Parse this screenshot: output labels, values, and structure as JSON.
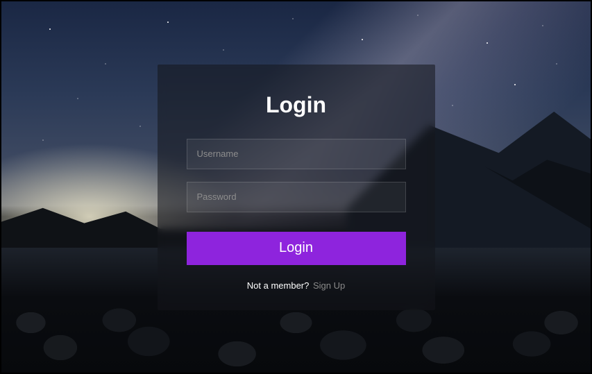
{
  "form": {
    "title": "Login",
    "username_placeholder": "Username",
    "username_value": "",
    "password_placeholder": "Password",
    "password_value": "",
    "submit_label": "Login"
  },
  "footer": {
    "prompt": "Not a member?",
    "link_label": "Sign Up"
  },
  "colors": {
    "accent": "#8e24dd"
  }
}
